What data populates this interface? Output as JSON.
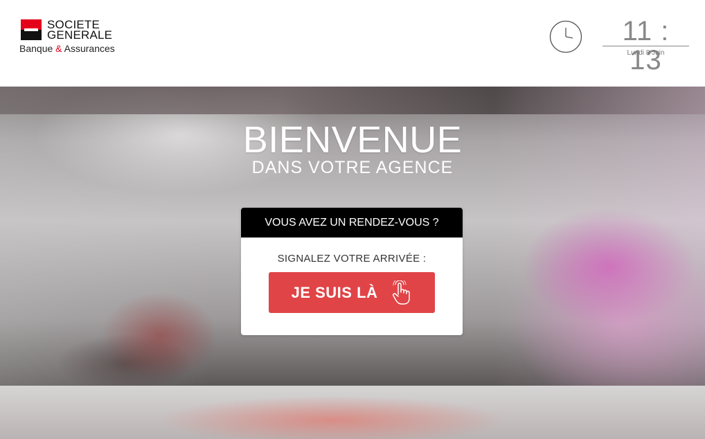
{
  "header": {
    "logo": {
      "name_line1": "SOCIETE",
      "name_line2": "GENERALE",
      "tagline_part1": "Banque",
      "tagline_amp": "&",
      "tagline_part2": "Assurances",
      "brand_red": "#e4001b"
    },
    "clock": {
      "icon": "clock-icon",
      "time": "11 : 13",
      "date": "Lundi 8 Juin"
    }
  },
  "welcome": {
    "title": "BIENVENUE",
    "subtitle": "DANS VOTRE AGENCE"
  },
  "card": {
    "header": "VOUS AVEZ UN RENDEZ-VOUS ?",
    "label": "SIGNALEZ VOTRE ARRIVÉE :",
    "button_label": "JE SUIS LÀ",
    "button_icon": "pointing-hand-icon",
    "button_color": "#e04447"
  }
}
